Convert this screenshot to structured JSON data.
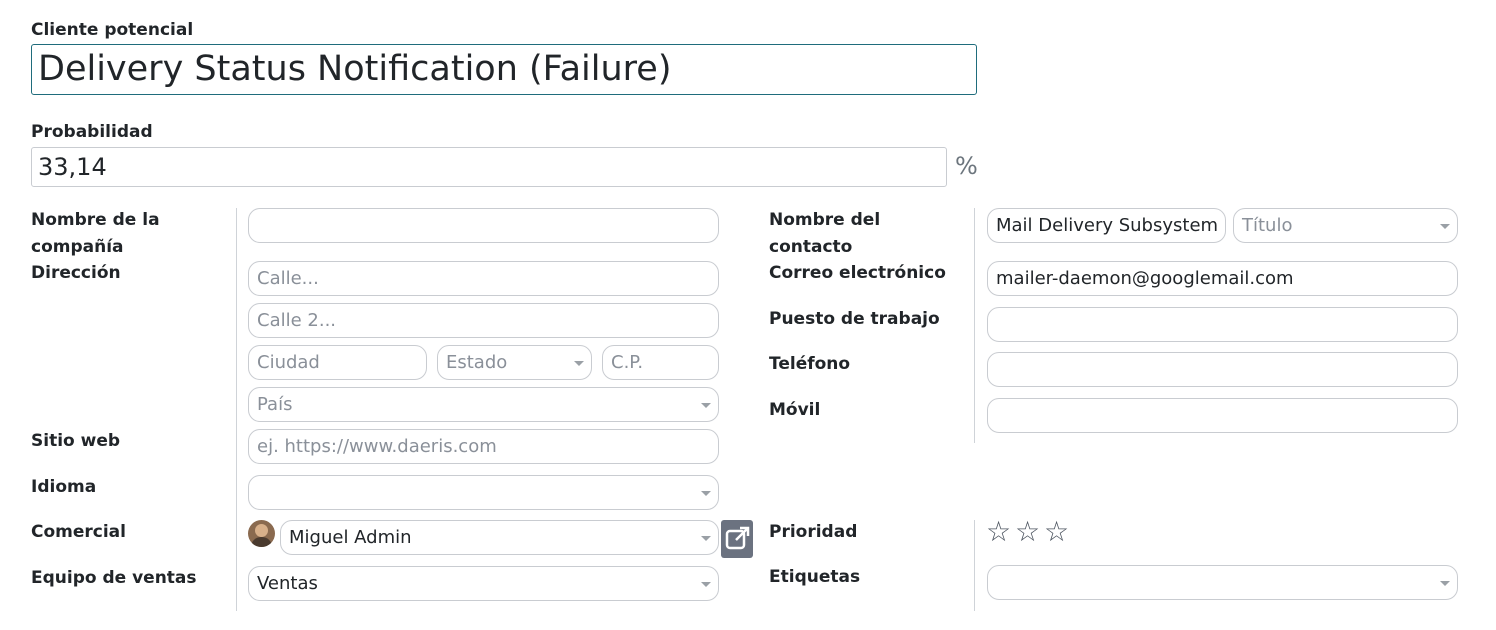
{
  "lead": {
    "label": "Cliente potencial",
    "name": "Delivery Status Notification (Failure)"
  },
  "probability": {
    "label": "Probabilidad",
    "value": "33,14",
    "unit": "%"
  },
  "left": {
    "company_label": "Nombre de la compañía",
    "company_value": "",
    "address_label": "Dirección",
    "street_placeholder": "Calle...",
    "street2_placeholder": "Calle 2...",
    "city_placeholder": "Ciudad",
    "state_placeholder": "Estado",
    "zip_placeholder": "C.P.",
    "country_placeholder": "País",
    "website_label": "Sitio web",
    "website_placeholder": "ej. https://www.daeris.com",
    "language_label": "Idioma",
    "language_value": "",
    "salesperson_label": "Comercial",
    "salesperson_value": "Miguel Admin",
    "team_label": "Equipo de ventas",
    "team_value": "Ventas"
  },
  "right": {
    "contact_label": "Nombre del contacto",
    "contact_value": "Mail Delivery Subsystem",
    "title_placeholder": "Título",
    "email_label": "Correo electrónico",
    "email_value": "mailer-daemon@googlemail.com",
    "job_label": "Puesto de trabajo",
    "phone_label": "Teléfono",
    "mobile_label": "Móvil",
    "priority_label": "Prioridad",
    "priority_stars_filled": 0,
    "priority_stars_total": 3,
    "tags_label": "Etiquetas"
  },
  "icons": {
    "external_link": "external-link-icon",
    "star": "star-outline-icon",
    "caret": "caret-down-icon",
    "avatar": "user-avatar"
  },
  "colors": {
    "focus_border": "#1f6c7c",
    "external_button_bg": "#6b7280"
  }
}
